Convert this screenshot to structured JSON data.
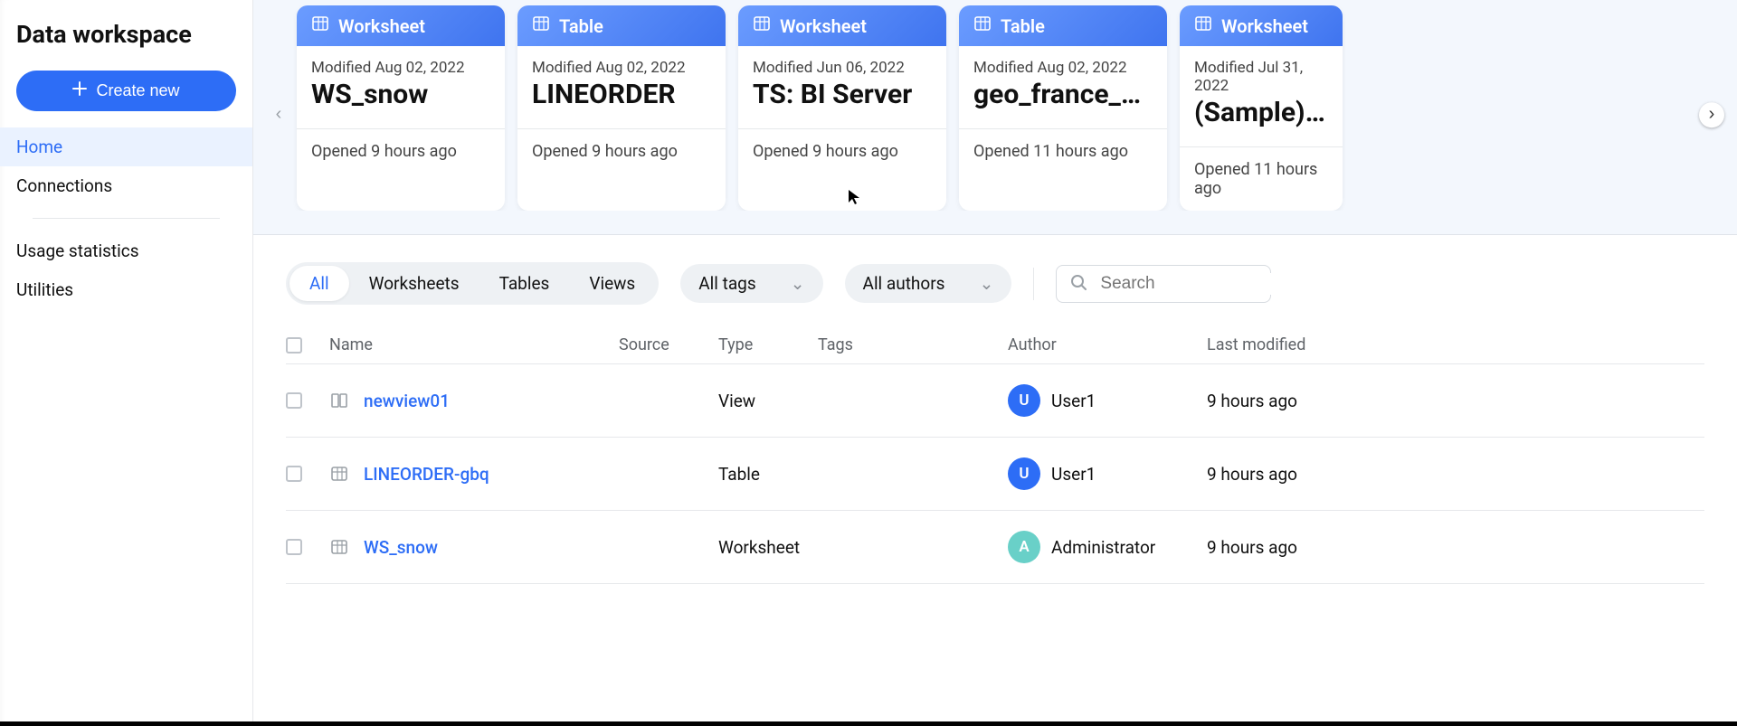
{
  "sidebar": {
    "title": "Data workspace",
    "create_label": "Create new",
    "nav": {
      "home": "Home",
      "connections": "Connections",
      "usage": "Usage statistics",
      "utilities": "Utilities"
    }
  },
  "cards": [
    {
      "kind": "Worksheet",
      "modified": "Modified Aug 02, 2022",
      "name": "WS_snow",
      "opened": "Opened 9 hours ago"
    },
    {
      "kind": "Table",
      "modified": "Modified Aug 02, 2022",
      "name": "LINEORDER",
      "opened": "Opened 9 hours ago"
    },
    {
      "kind": "Worksheet",
      "modified": "Modified Jun 06, 2022",
      "name": "TS: BI Server",
      "opened": "Opened 9 hours ago"
    },
    {
      "kind": "Table",
      "modified": "Modified Aug 02, 2022",
      "name": "geo_france_pop…",
      "opened": "Opened 11 hours ago"
    },
    {
      "kind": "Worksheet",
      "modified": "Modified Jul 31, 2022",
      "name": "(Sample) Retail",
      "opened": "Opened 11 hours ago"
    }
  ],
  "filters": {
    "tabs": {
      "all": "All",
      "worksheets": "Worksheets",
      "tables": "Tables",
      "views": "Views"
    },
    "tags_label": "All tags",
    "authors_label": "All authors",
    "search_placeholder": "Search"
  },
  "columns": {
    "name": "Name",
    "source": "Source",
    "type": "Type",
    "tags": "Tags",
    "author": "Author",
    "last_modified": "Last modified"
  },
  "rows": [
    {
      "name": "newview01",
      "type": "View",
      "author_initial": "U",
      "author": "User1",
      "avatar_color": "#2d6df6",
      "last_modified": "9 hours ago"
    },
    {
      "name": "LINEORDER-gbq",
      "type": "Table",
      "author_initial": "U",
      "author": "User1",
      "avatar_color": "#2d6df6",
      "last_modified": "9 hours ago"
    },
    {
      "name": "WS_snow",
      "type": "Worksheet",
      "author_initial": "A",
      "author": "Administrator",
      "avatar_color": "#69d0c8",
      "last_modified": "9 hours ago"
    }
  ]
}
